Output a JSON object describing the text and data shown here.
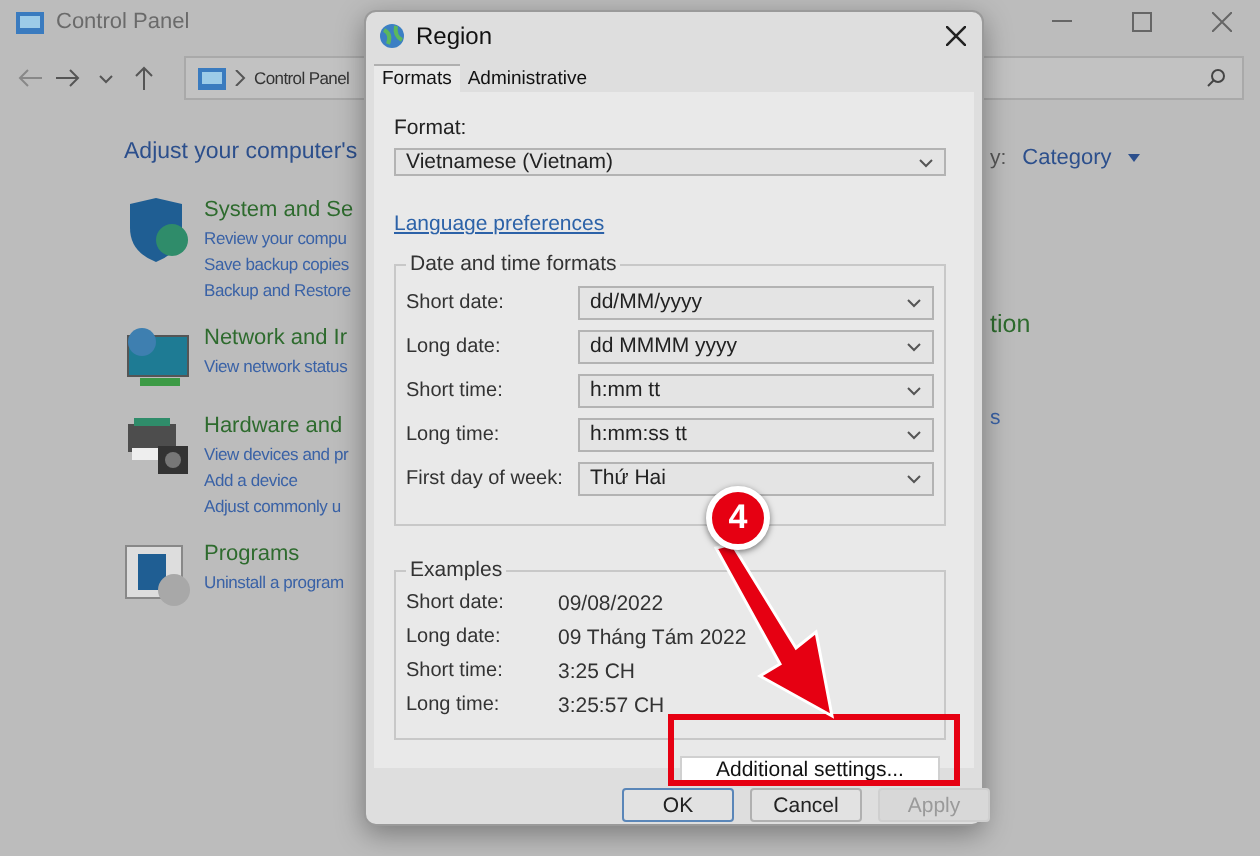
{
  "control_panel": {
    "title": "Control Panel",
    "breadcrumb": "Control Panel",
    "heading": "Adjust your computer's",
    "view_by": "y:",
    "view_value": "Category",
    "categories": [
      {
        "kind": "shield",
        "title": "System and Se",
        "links": [
          "Review your compu",
          "Save backup copies",
          "Backup and Restore"
        ]
      },
      {
        "kind": "network",
        "title": "Network and Ir",
        "links": [
          "View network status"
        ]
      },
      {
        "kind": "printer",
        "title": "Hardware and",
        "links": [
          "View devices and pr",
          "Add a device",
          "Adjust commonly u"
        ]
      },
      {
        "kind": "programs",
        "title": "Programs",
        "links": [
          "Uninstall a program"
        ]
      }
    ],
    "right_fragments": [
      {
        "kind": "title",
        "text": "tion"
      },
      {
        "kind": "link",
        "text": "s"
      }
    ]
  },
  "dialog": {
    "title": "Region",
    "tabs": [
      {
        "label": "Formats",
        "selected": true
      },
      {
        "label": "Administrative",
        "selected": false
      }
    ],
    "format_label": "Format:",
    "format_value": "Vietnamese (Vietnam)",
    "link": "Language preferences",
    "date_group": {
      "title": "Date and time formats",
      "rows": [
        {
          "label": "Short date:",
          "value": "dd/MM/yyyy"
        },
        {
          "label": "Long date:",
          "value": "dd MMMM yyyy"
        },
        {
          "label": "Short time:",
          "value": "h:mm tt"
        },
        {
          "label": "Long time:",
          "value": "h:mm:ss tt"
        },
        {
          "label": "First day of week:",
          "value": "Thứ Hai"
        }
      ]
    },
    "examples": {
      "title": "Examples",
      "rows": [
        {
          "label": "Short date:",
          "value": "09/08/2022"
        },
        {
          "label": "Long date:",
          "value": "09 Tháng Tám 2022"
        },
        {
          "label": "Short time:",
          "value": "3:25 CH"
        },
        {
          "label": "Long time:",
          "value": "3:25:57 CH"
        }
      ]
    },
    "additional_button": "Additional settings...",
    "buttons": [
      {
        "label": "OK",
        "disabled": false,
        "default": true
      },
      {
        "label": "Cancel",
        "disabled": false,
        "default": false
      },
      {
        "label": "Apply",
        "disabled": true,
        "default": false
      }
    ]
  },
  "annotation": {
    "step": "4"
  }
}
